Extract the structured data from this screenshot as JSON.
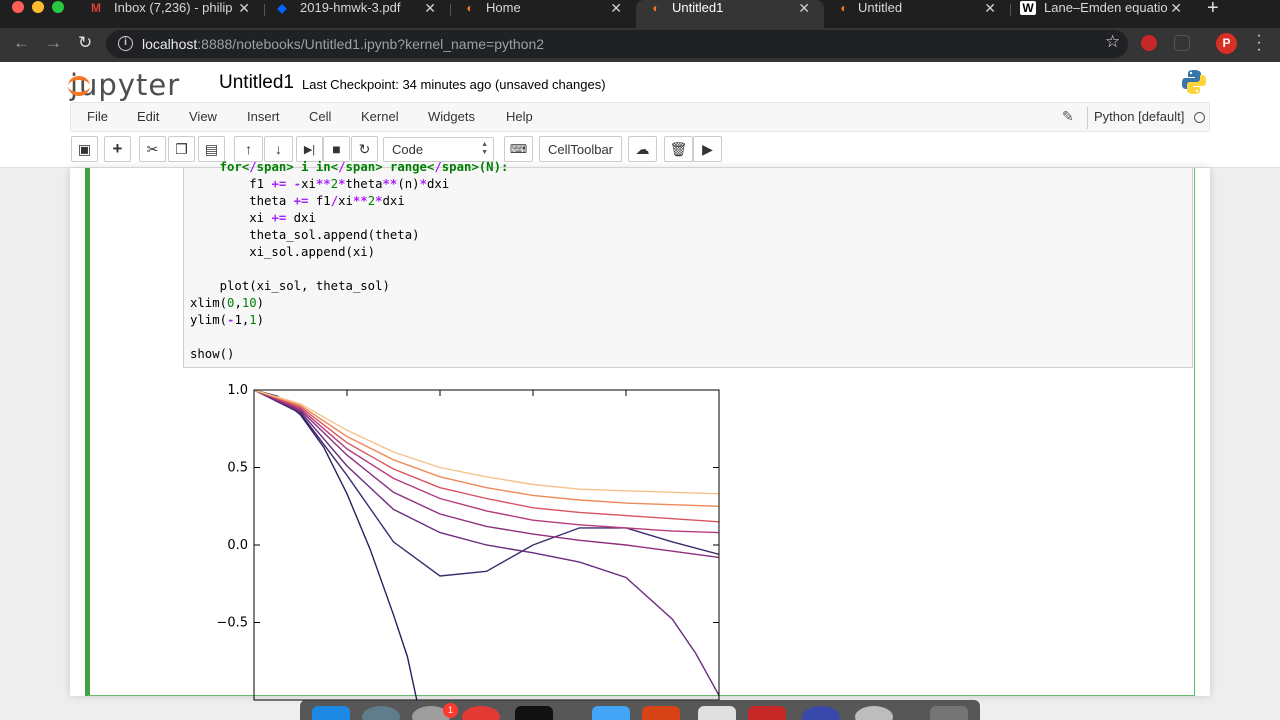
{
  "browser": {
    "tabs": [
      {
        "label": "Inbox (7,236) - philip",
        "icon": "gmail-icon",
        "color": "#d44638"
      },
      {
        "label": "2019-hmwk-3.pdf",
        "icon": "dropbox-icon",
        "color": "#0061fe"
      },
      {
        "label": "Home",
        "icon": "jupyter-icon",
        "color": "#f37726"
      },
      {
        "label": "Untitled1",
        "icon": "jupyter-icon",
        "color": "#f37726",
        "active": true
      },
      {
        "label": "Untitled",
        "icon": "jupyter-icon",
        "color": "#f37726"
      },
      {
        "label": "Lane–Emden equatio",
        "icon": "wikipedia-icon",
        "color": "#ffffff"
      }
    ],
    "url_host": "localhost",
    "url_rest": ":8888/notebooks/Untitled1.ipynb?kernel_name=python2",
    "profile_initial": "P"
  },
  "jupyter": {
    "logo_text": "jupyter",
    "notebook_name": "Untitled1",
    "checkpoint": "Last Checkpoint: 34 minutes ago (unsaved changes)",
    "menu": [
      "File",
      "Edit",
      "View",
      "Insert",
      "Cell",
      "Kernel",
      "Widgets",
      "Help"
    ],
    "kernel_name": "Python [default]",
    "cell_type": "Code",
    "celltoolbar_label": "CellToolbar"
  },
  "code_lines": [
    "    for i in range(N):",
    "        f1 += -xi**2*theta**(n)*dxi",
    "        theta += f1/xi**2*dxi",
    "        xi += dxi",
    "        theta_sol.append(theta)",
    "        xi_sol.append(xi)",
    "",
    "    plot(xi_sol, theta_sol)",
    "xlim(0,10)",
    "ylim(-1,1)",
    "",
    "show()"
  ],
  "chart_data": {
    "type": "line",
    "xlim": [
      0,
      10
    ],
    "ylim": [
      -1,
      1
    ],
    "y_ticks": [
      "1.0",
      "0.5",
      "0.0",
      "−0.5"
    ],
    "grid": false,
    "series": [
      {
        "color": "#2d1e5e",
        "x": [
          0,
          0.5,
          1.0,
          1.5,
          2.0,
          2.5,
          3.0,
          3.3,
          3.5
        ],
        "y": [
          1.0,
          0.96,
          0.84,
          0.63,
          0.33,
          -0.03,
          -0.45,
          -0.72,
          -1.0
        ]
      },
      {
        "color": "#3f2a6e",
        "x": [
          0,
          1,
          2,
          3,
          4,
          5,
          6,
          7,
          8,
          9,
          10
        ],
        "y": [
          1.0,
          0.85,
          0.45,
          0.02,
          -0.2,
          -0.17,
          0.0,
          0.11,
          0.11,
          0.02,
          -0.06
        ]
      },
      {
        "color": "#6b2c7e",
        "x": [
          0,
          1,
          2,
          3,
          4,
          5,
          6,
          7,
          8,
          9,
          9.5,
          10
        ],
        "y": [
          1.0,
          0.86,
          0.51,
          0.23,
          0.08,
          0.0,
          -0.05,
          -0.11,
          -0.21,
          -0.48,
          -0.7,
          -0.97
        ]
      },
      {
        "color": "#8e2f7d",
        "x": [
          0,
          1,
          2,
          3,
          4,
          5,
          6,
          7,
          8,
          9,
          10
        ],
        "y": [
          1.0,
          0.87,
          0.58,
          0.34,
          0.2,
          0.12,
          0.07,
          0.03,
          0.0,
          -0.04,
          -0.08
        ]
      },
      {
        "color": "#b53a7a",
        "x": [
          0,
          1,
          2,
          3,
          4,
          5,
          6,
          7,
          8,
          9,
          10
        ],
        "y": [
          1.0,
          0.88,
          0.62,
          0.43,
          0.3,
          0.22,
          0.16,
          0.13,
          0.11,
          0.09,
          0.08
        ]
      },
      {
        "color": "#d9535f",
        "x": [
          0,
          1,
          2,
          3,
          4,
          5,
          6,
          7,
          8,
          9,
          10
        ],
        "y": [
          1.0,
          0.89,
          0.66,
          0.49,
          0.37,
          0.3,
          0.24,
          0.21,
          0.19,
          0.17,
          0.15
        ]
      },
      {
        "color": "#ee8a5a",
        "x": [
          0,
          1,
          2,
          3,
          4,
          5,
          6,
          7,
          8,
          9,
          10
        ],
        "y": [
          1.0,
          0.9,
          0.7,
          0.55,
          0.44,
          0.37,
          0.32,
          0.29,
          0.27,
          0.26,
          0.25
        ]
      },
      {
        "color": "#f6c18a",
        "x": [
          0,
          1,
          2,
          3,
          4,
          5,
          6,
          7,
          8,
          9,
          10
        ],
        "y": [
          1.0,
          0.91,
          0.74,
          0.6,
          0.5,
          0.44,
          0.39,
          0.36,
          0.35,
          0.34,
          0.33
        ]
      }
    ]
  },
  "dock": {
    "badge_count": "1"
  }
}
